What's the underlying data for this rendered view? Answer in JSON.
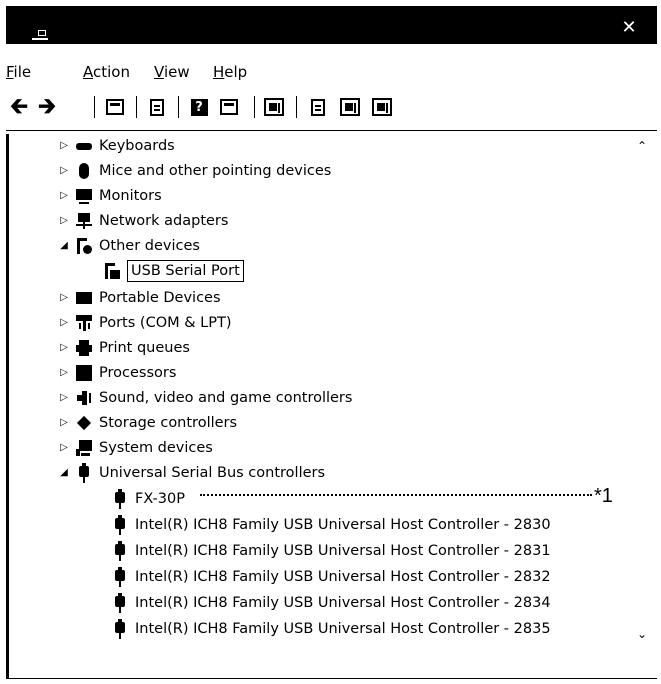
{
  "window": {
    "close_glyph": "✕"
  },
  "menu": {
    "file": {
      "accel": "F",
      "rest": "ile"
    },
    "action": {
      "accel": "A",
      "rest": "ction"
    },
    "view": {
      "accel": "V",
      "rest": "iew"
    },
    "help": {
      "accel": "H",
      "rest": "elp"
    }
  },
  "toolbar": {
    "back_glyph": "🡰",
    "forward_glyph": "🡲",
    "help_glyph": "?"
  },
  "tree": {
    "keyboards": "Keyboards",
    "mice": "Mice and other pointing devices",
    "monitors": "Monitors",
    "network": "Network adapters",
    "other": "Other devices",
    "usb_serial": "USB Serial Port",
    "portable": "Portable Devices",
    "ports": "Ports (COM & LPT)",
    "print": "Print queues",
    "processors": "Processors",
    "sound": "Sound, video and game controllers",
    "storage": "Storage controllers",
    "system": "System devices",
    "usb_controllers": "Universal Serial Bus controllers",
    "usb_children": [
      "FX-30P",
      "Intel(R) ICH8 Family USB Universal Host Controller - 2830",
      "Intel(R) ICH8 Family USB Universal Host Controller - 2831",
      "Intel(R) ICH8 Family USB Universal Host Controller - 2832",
      "Intel(R) ICH8 Family USB Universal Host Controller - 2834",
      "Intel(R) ICH8 Family USB Universal Host Controller - 2835"
    ]
  },
  "glyphs": {
    "collapsed": "▷",
    "expanded": "◢",
    "scroll_up": "⌃",
    "scroll_down": "⌄"
  },
  "annotation": "*1"
}
